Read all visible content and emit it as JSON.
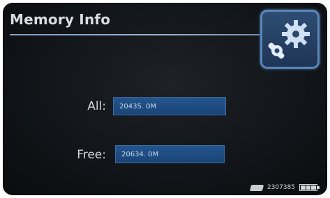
{
  "header": {
    "title": "Memory Info"
  },
  "settings": {
    "icon": "settings-gear-wrench-icon"
  },
  "memory": {
    "all_label": "All:",
    "all_value": "20435. 0M",
    "free_label": "Free:",
    "free_value": "20634. 0M"
  },
  "status": {
    "storage_icon": "memory-card-icon",
    "time": "2307385",
    "battery_icon": "battery-icon"
  },
  "colors": {
    "accent": "#5a85b8",
    "field": "#1f4b82"
  }
}
